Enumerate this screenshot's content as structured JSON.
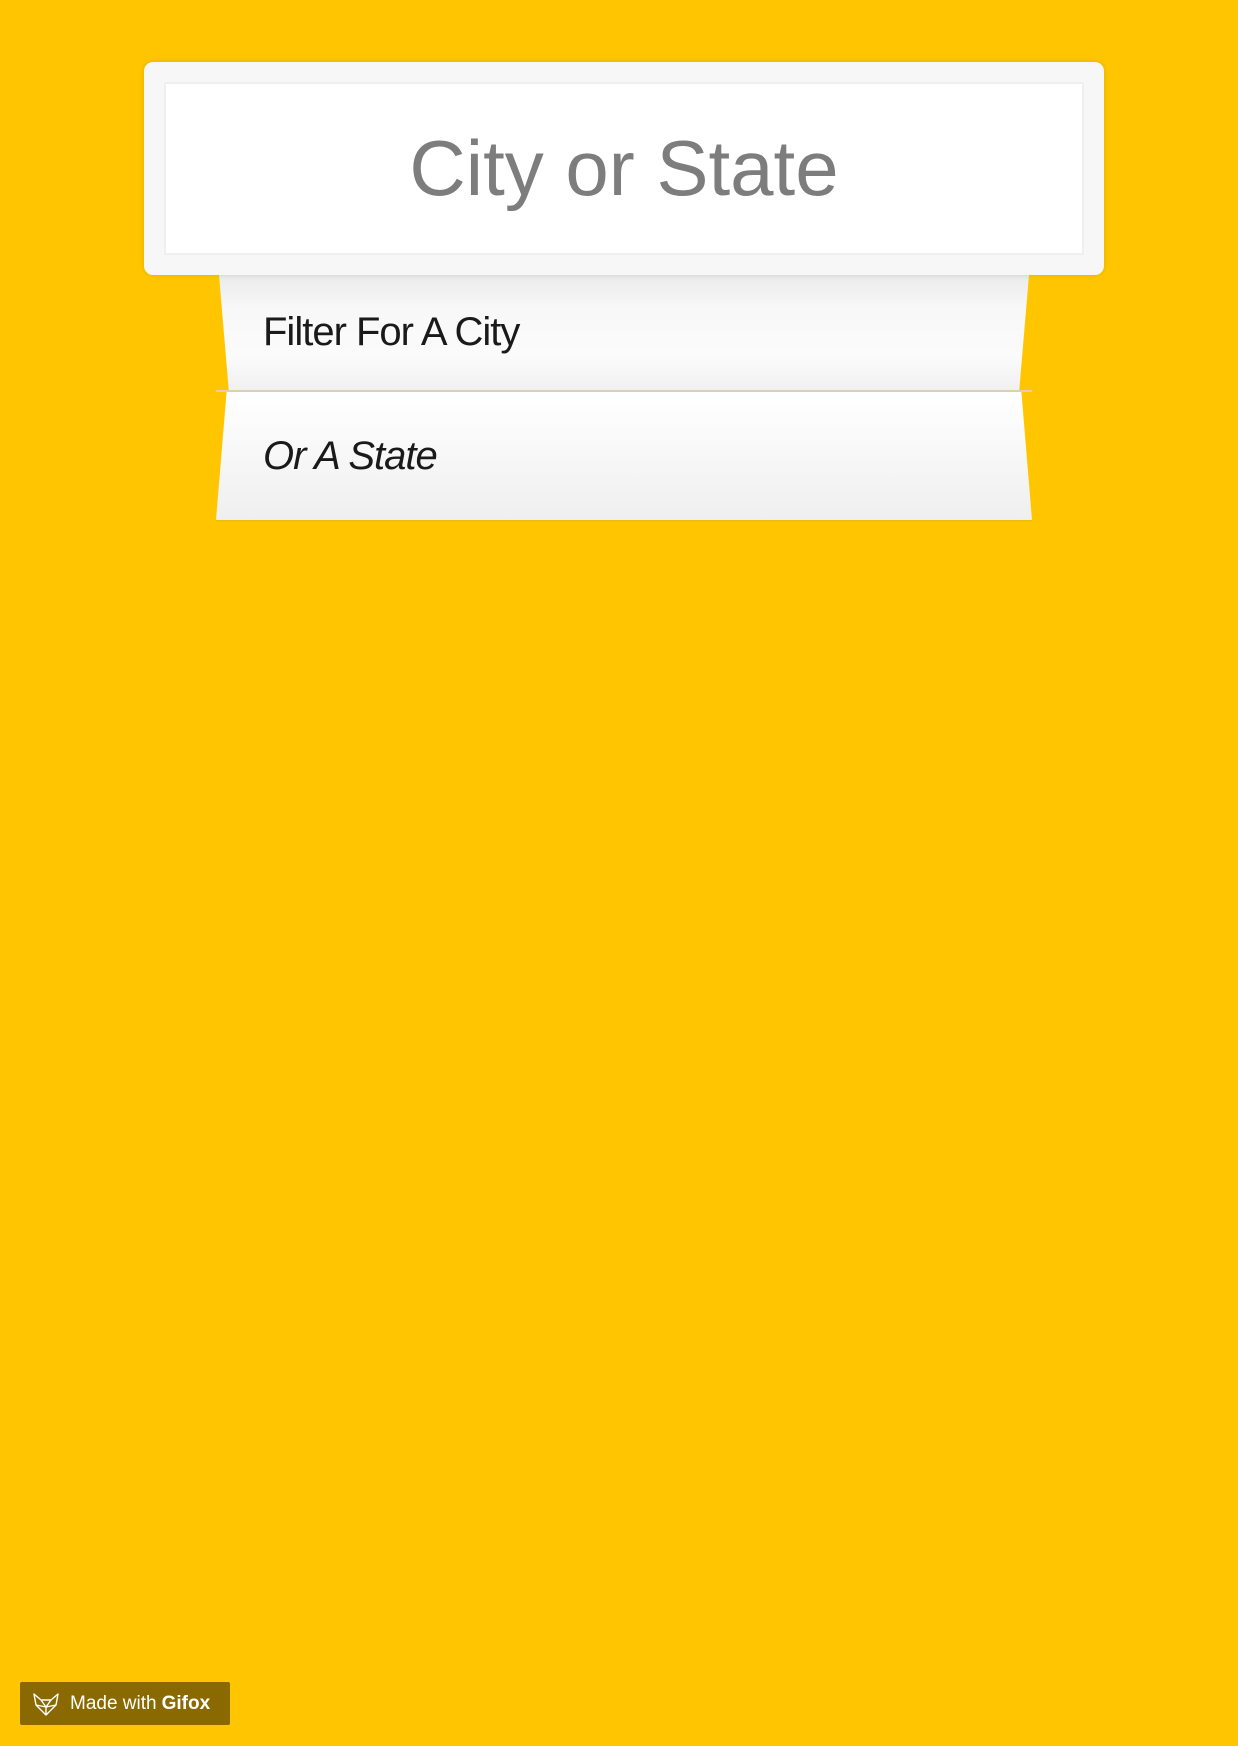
{
  "search": {
    "placeholder": "City or State"
  },
  "suggestions": [
    {
      "label": "Filter For A City"
    },
    {
      "label": "Or A State"
    }
  ],
  "watermark": {
    "made_with": "Made with",
    "brand": "Gifox"
  },
  "colors": {
    "background": "#ffc600",
    "input_text": "#7d7d7d",
    "watermark_bg": "#8a6a00"
  },
  "icons": {
    "watermark": "fox-logo-icon"
  }
}
